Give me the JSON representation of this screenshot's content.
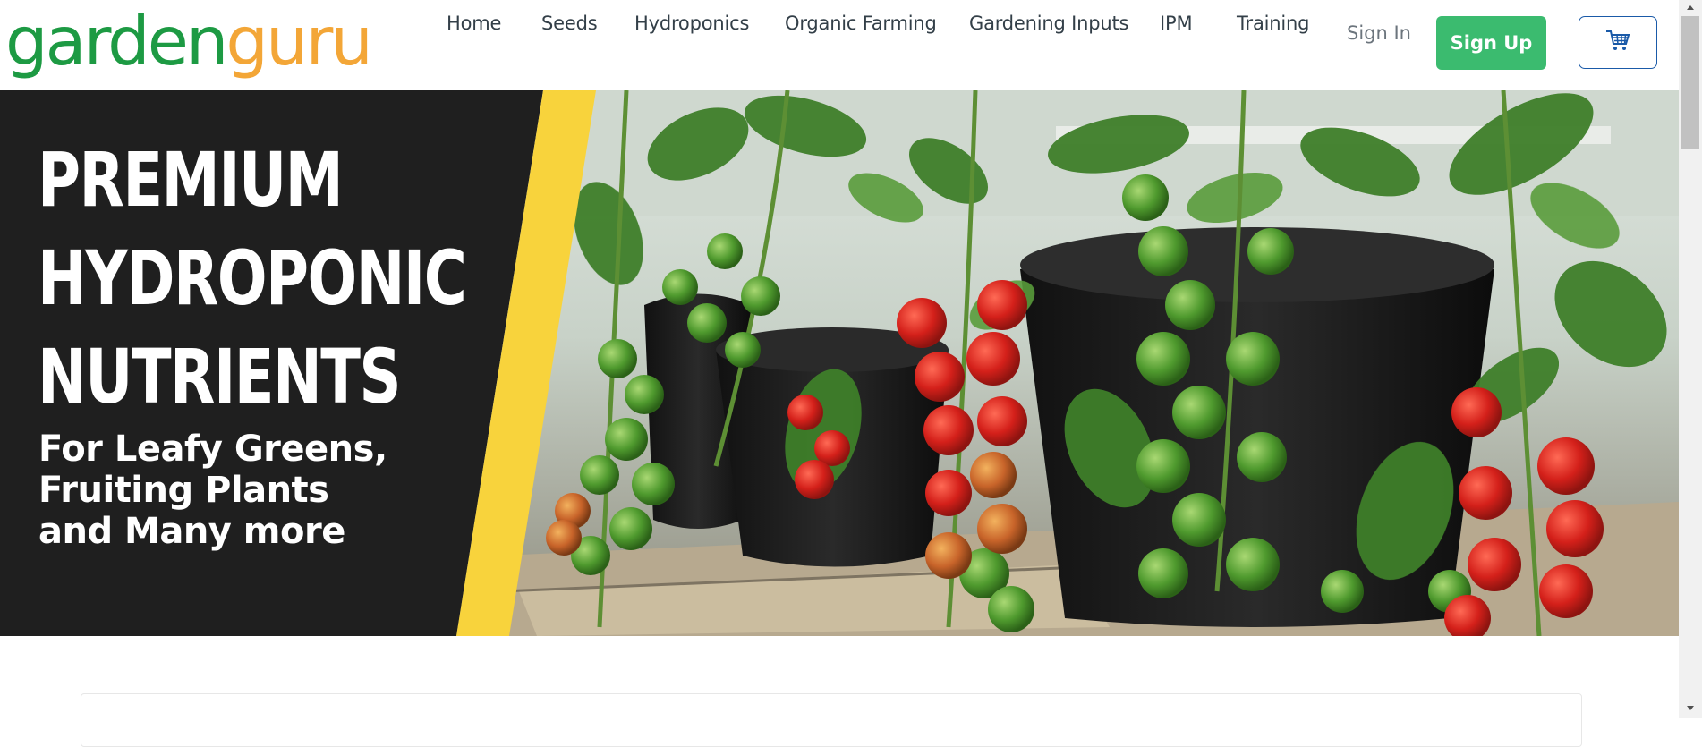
{
  "brand": {
    "part1": "garden",
    "part2": "guru",
    "color1": "#1d9a43",
    "color2": "#f3a637"
  },
  "nav": {
    "items": [
      {
        "label": "Home"
      },
      {
        "label": "Seeds"
      },
      {
        "label": "Hydroponics"
      },
      {
        "label": "Organic Farming"
      },
      {
        "label": "Gardening Inputs"
      },
      {
        "label": "IPM"
      },
      {
        "label": "Training"
      }
    ],
    "signin_label": "Sign In",
    "signup_label": "Sign Up",
    "cart_icon": "shopping-cart-icon"
  },
  "hero": {
    "headline": [
      "PREMIUM",
      "HYDROPONIC",
      "NUTRIENTS"
    ],
    "subhead": [
      "For Leafy Greens,",
      "Fruiting Plants",
      "and Many more"
    ],
    "accent": "#f8d33c",
    "panel_color": "#1f1f1f"
  },
  "colors": {
    "primary": "#3bbb6f",
    "cart_border": "#1a5aa8",
    "nav_text": "#333f48",
    "muted": "#6c757d"
  }
}
